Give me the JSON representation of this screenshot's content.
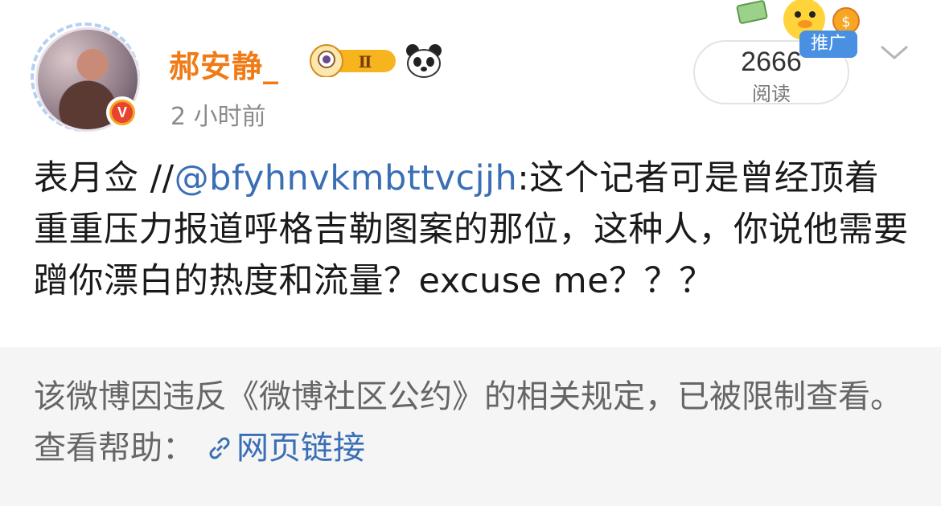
{
  "post": {
    "username": "郝安静_",
    "medal_text": "Ⅱ",
    "timestamp": "2 小时前",
    "read_count": "2666",
    "read_label": "阅读",
    "promo_tag": "推广",
    "verified_badge": "V",
    "text_prefix": "表月佥 //",
    "mention": "@bfyhnvkmbttvcjjh",
    "text_body": ":这个记者可是曾经顶着重重压力报道呼格吉勒图案的那位，这种人，你说他需要蹭你漂白的热度和流量？excuse me？？？"
  },
  "notice": {
    "text": "该微博因违反《微博社区公约》的相关规定，已被限制查看。查看帮助：",
    "link_label": "网页链接"
  },
  "colors": {
    "username": "#f07b16",
    "mention": "#3a6fb5",
    "promo_tag": "#4a90e2",
    "notice_bg": "#f5f5f5"
  },
  "icons": [
    "avatar",
    "verified-badge",
    "medal-icon",
    "panda-icon",
    "dropdown-chevron-icon",
    "link-icon"
  ]
}
